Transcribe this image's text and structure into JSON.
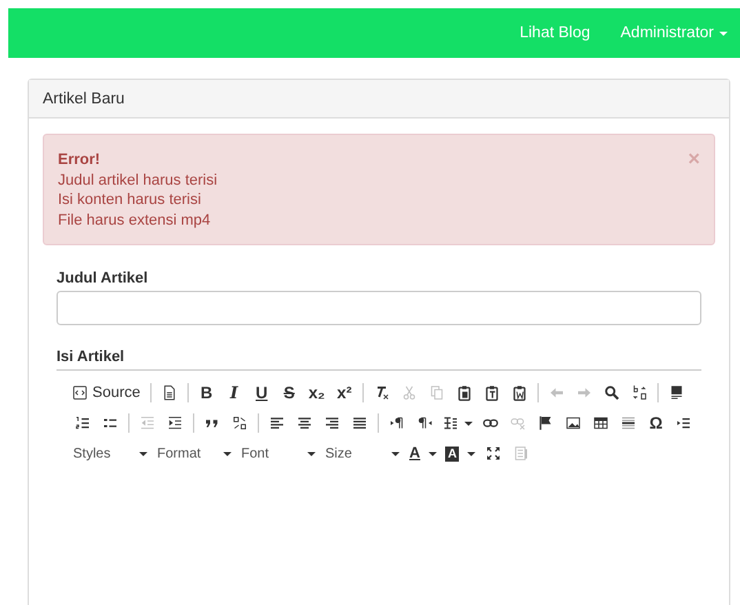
{
  "navbar": {
    "links": [
      {
        "label": "Lihat Blog",
        "dropdown": false
      },
      {
        "label": "Administrator",
        "dropdown": true
      }
    ]
  },
  "panel": {
    "title": "Artikel Baru"
  },
  "alert": {
    "heading": "Error!",
    "messages": [
      "Judul artikel harus terisi",
      "Isi konten harus terisi",
      "File harus extensi mp4"
    ],
    "close": "×"
  },
  "fields": [
    {
      "label": "Judul Artikel"
    }
  ],
  "editor": {
    "label": "Isi Artikel",
    "toolbar": [
      [
        {
          "kind": "button",
          "label": "Source",
          "disabled": false
        },
        {
          "kind": "separator"
        },
        {
          "kind": "icon",
          "disabled": false
        },
        {
          "kind": "separator"
        },
        {
          "kind": "bold",
          "label": "B",
          "disabled": false
        },
        {
          "kind": "italic",
          "label": "I",
          "disabled": false
        },
        {
          "kind": "underline",
          "label": "U",
          "disabled": false
        },
        {
          "kind": "strike",
          "label": "S",
          "disabled": false
        },
        {
          "kind": "glyph",
          "label": "x₂",
          "disabled": false
        },
        {
          "kind": "glyph",
          "label": "x²",
          "disabled": false
        },
        {
          "kind": "separator"
        },
        {
          "kind": "icon",
          "disabled": false
        },
        {
          "kind": "icon",
          "disabled": true
        },
        {
          "kind": "icon",
          "disabled": true
        },
        {
          "kind": "icon",
          "disabled": false
        },
        {
          "kind": "icon",
          "disabled": false
        },
        {
          "kind": "icon",
          "disabled": false
        },
        {
          "kind": "separator"
        },
        {
          "kind": "icon",
          "disabled": true
        },
        {
          "kind": "icon",
          "disabled": true
        },
        {
          "kind": "icon",
          "disabled": false
        },
        {
          "kind": "icon",
          "disabled": false
        },
        {
          "kind": "separator"
        },
        {
          "kind": "icon",
          "disabled": false
        }
      ],
      [
        {
          "kind": "icon",
          "disabled": false
        },
        {
          "kind": "icon",
          "disabled": false
        },
        {
          "kind": "separator"
        },
        {
          "kind": "icon",
          "disabled": true
        },
        {
          "kind": "icon",
          "disabled": false
        },
        {
          "kind": "separator"
        },
        {
          "kind": "icon",
          "disabled": false
        },
        {
          "kind": "icon",
          "disabled": false
        },
        {
          "kind": "separator"
        },
        {
          "kind": "icon",
          "disabled": false
        },
        {
          "kind": "icon",
          "disabled": false
        },
        {
          "kind": "icon",
          "disabled": false
        },
        {
          "kind": "icon",
          "disabled": false
        },
        {
          "kind": "separator"
        },
        {
          "kind": "icon",
          "disabled": false
        },
        {
          "kind": "icon",
          "disabled": false
        },
        {
          "kind": "icon-menu",
          "disabled": false
        },
        {
          "kind": "icon",
          "disabled": false
        },
        {
          "kind": "icon",
          "disabled": true
        },
        {
          "kind": "icon",
          "disabled": false
        },
        {
          "kind": "icon",
          "disabled": false
        },
        {
          "kind": "icon",
          "disabled": false
        },
        {
          "kind": "icon",
          "disabled": false
        },
        {
          "kind": "glyph",
          "label": "Ω",
          "disabled": false
        },
        {
          "kind": "icon",
          "disabled": false
        }
      ],
      [
        {
          "kind": "combo",
          "label": "Styles",
          "disabled": false
        },
        {
          "kind": "combo",
          "label": "Format",
          "disabled": false
        },
        {
          "kind": "combo",
          "label": "Font",
          "disabled": false
        },
        {
          "kind": "combo",
          "label": "Size",
          "disabled": false
        },
        {
          "kind": "color",
          "label": "A",
          "disabled": false
        },
        {
          "kind": "color-fill",
          "label": "A",
          "disabled": false
        },
        {
          "kind": "icon",
          "disabled": false
        },
        {
          "kind": "icon",
          "disabled": true
        }
      ]
    ]
  }
}
